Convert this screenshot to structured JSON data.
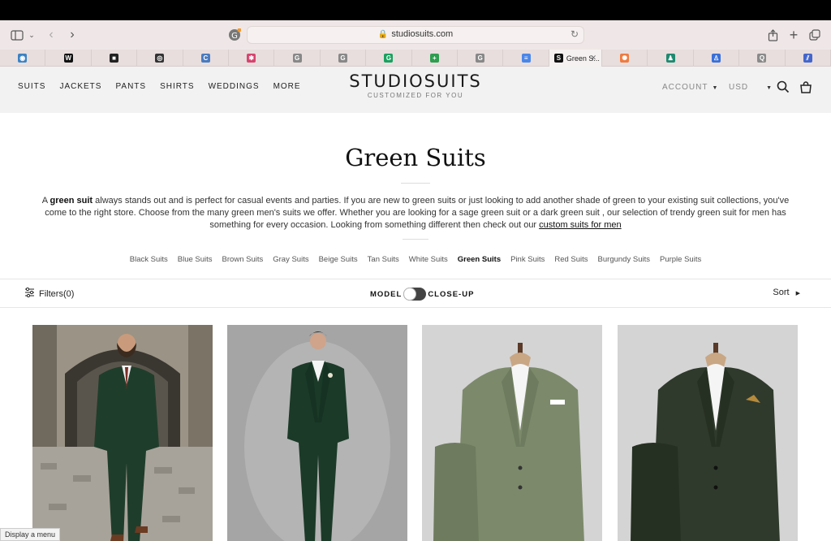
{
  "browser": {
    "url": "studiosuits.com",
    "active_tab_label": "Green S...",
    "tabs": [
      {
        "icon": "globe-tab-icon",
        "glyph": "◉",
        "color": "#3b82c4"
      },
      {
        "icon": "w-tab-icon",
        "glyph": "W",
        "color": "#111111"
      },
      {
        "icon": "dark-square-tab-icon",
        "glyph": "■",
        "color": "#222222"
      },
      {
        "icon": "openai-tab-icon",
        "glyph": "◎",
        "color": "#333333"
      },
      {
        "icon": "c-tab-icon",
        "glyph": "C",
        "color": "#4a7bbf"
      },
      {
        "icon": "slack-tab-icon",
        "glyph": "✱",
        "color": "#d6456f"
      },
      {
        "icon": "g-tab-icon",
        "glyph": "G",
        "color": "#888888"
      },
      {
        "icon": "g-tab-icon",
        "glyph": "G",
        "color": "#888888"
      },
      {
        "icon": "grammarly-tab-icon",
        "glyph": "G",
        "color": "#1aa15f"
      },
      {
        "icon": "plus-tab-icon",
        "glyph": "+",
        "color": "#2e9e4f"
      },
      {
        "icon": "g-tab-icon",
        "glyph": "G",
        "color": "#888888"
      },
      {
        "icon": "docs-tab-icon",
        "glyph": "≡",
        "color": "#4a86e8"
      },
      {
        "icon": "studiosuits-tab-icon",
        "glyph": "S",
        "color": "#111111",
        "active": true
      },
      {
        "icon": "hubspot-tab-icon",
        "glyph": "✺",
        "color": "#f07b3f"
      },
      {
        "icon": "figure-tab-icon",
        "glyph": "♟",
        "color": "#1f8a70"
      },
      {
        "icon": "person-tab-icon",
        "glyph": "♙",
        "color": "#3a6fd8"
      },
      {
        "icon": "q-tab-icon",
        "glyph": "Q",
        "color": "#8a8a8a"
      },
      {
        "icon": "stripes-tab-icon",
        "glyph": "⫽",
        "color": "#4466cc"
      }
    ]
  },
  "header": {
    "nav": [
      "SUITS",
      "JACKETS",
      "PANTS",
      "SHIRTS",
      "WEDDINGS",
      "MORE"
    ],
    "brand": "STUDIOSUITS",
    "tagline": "CUSTOMIZED FOR YOU",
    "account": "ACCOUNT",
    "currency": "USD"
  },
  "page": {
    "title": "Green Suits",
    "intro": {
      "p1": "A ",
      "bold": "green suit",
      "p2": " always stands out and is perfect for casual events and parties. If you are new to green suits or just looking to add another shade of green to your existing suit collections, you've come to the right store. Choose from the many green men's suits we offer. Whether you are looking for a sage green suit or a dark green suit , our selection of trendy green suit for men has something for every occasion. Looking from something different then check out our ",
      "link": "custom suits for men"
    },
    "categories": [
      "Black Suits",
      "Blue Suits",
      "Brown Suits",
      "Gray Suits",
      "Beige Suits",
      "Tan Suits",
      "White Suits",
      "Green Suits",
      "Pink Suits",
      "Red Suits",
      "Burgundy Suits",
      "Purple Suits"
    ],
    "selected_category": "Green Suits"
  },
  "toolbar": {
    "filters": "Filters(0)",
    "toggle_left": "MODEL",
    "toggle_right": "CLOSE-UP",
    "sort": "Sort"
  },
  "products": [
    {
      "kind": "model-street",
      "suit_color": "#1f3d2b"
    },
    {
      "kind": "model-studio",
      "suit_color": "#1b3a28"
    },
    {
      "kind": "mannequin",
      "suit_color": "#7c8a6b"
    },
    {
      "kind": "mannequin",
      "suit_color": "#2f3a2c"
    }
  ],
  "hint": "Display a menu"
}
